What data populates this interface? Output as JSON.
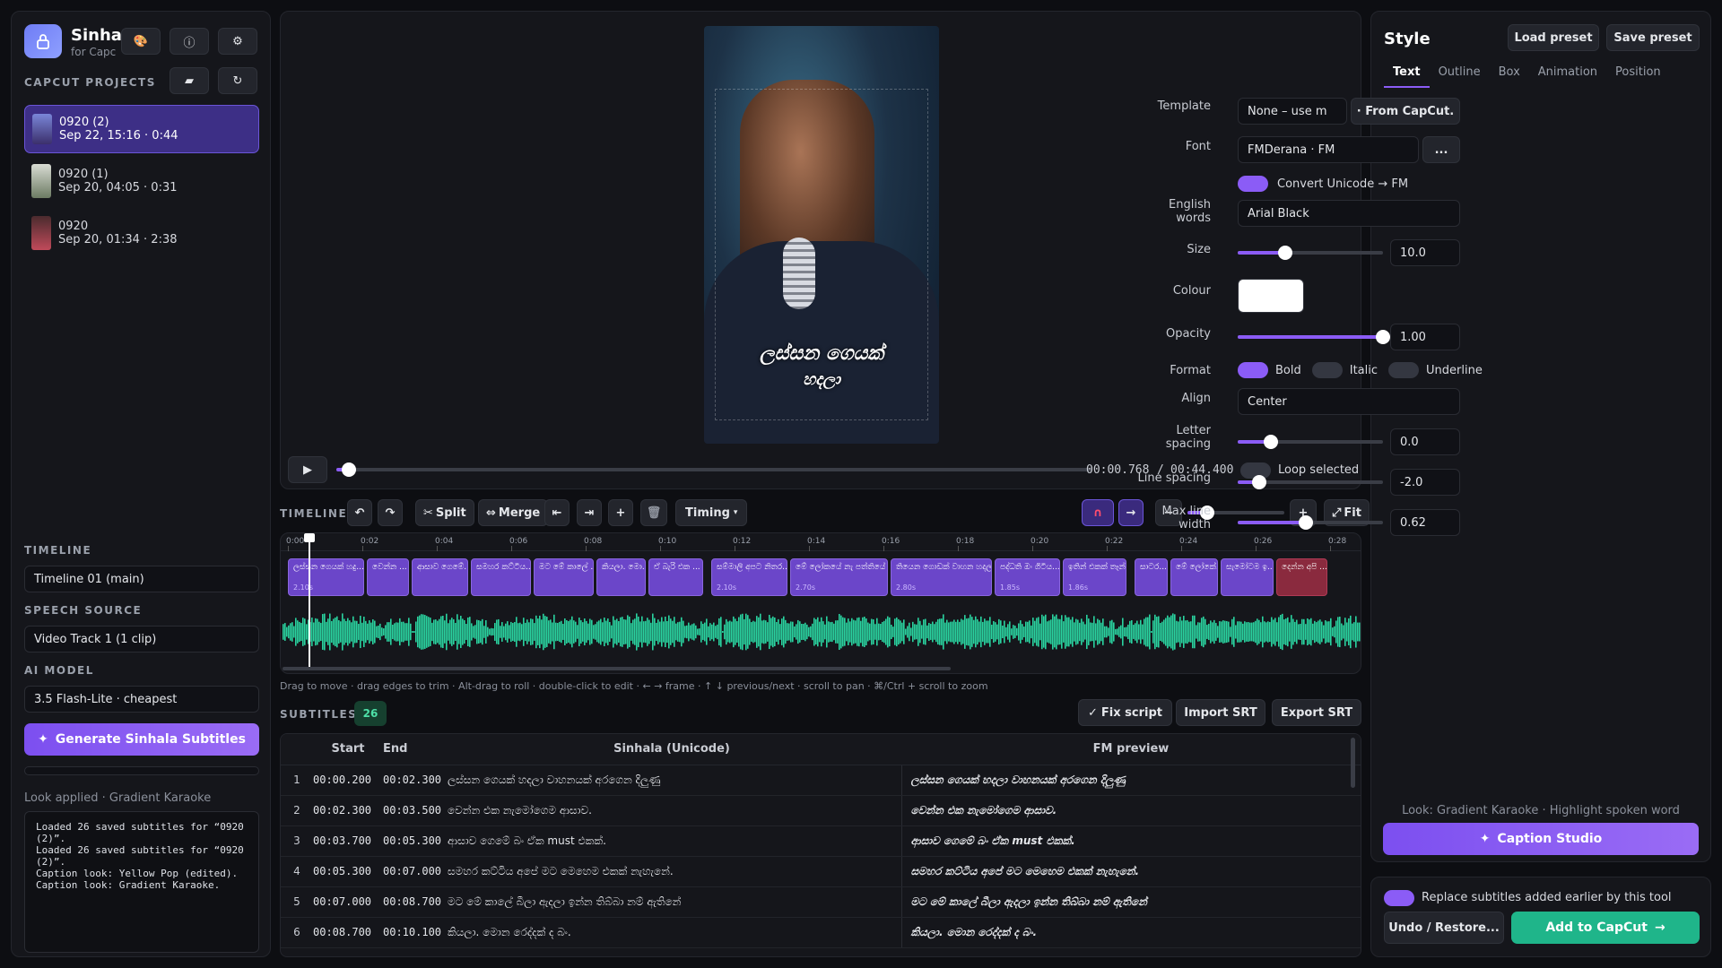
{
  "app": {
    "title": "Sinha",
    "subtitle": "for Capc",
    "logo_icon": "lock-icon"
  },
  "colors": {
    "accent": "#8b5cf6",
    "green": "#1fb58a",
    "waveform": "#2ad3a0",
    "bg": "#0d0e12"
  },
  "projects": {
    "heading": "CAPCUT PROJECTS",
    "items": [
      {
        "name": "0920 (2)",
        "meta": "Sep 22, 15:16 · 0:44",
        "selected": true
      },
      {
        "name": "0920 (1)",
        "meta": "Sep 20, 04:05 · 0:31",
        "selected": false
      },
      {
        "name": "0920",
        "meta": "Sep 20, 01:34 · 2:38",
        "selected": false
      }
    ]
  },
  "left": {
    "timeline_label": "TIMELINE",
    "timeline_value": "Timeline 01  (main)",
    "speech_label": "SPEECH SOURCE",
    "speech_value": "Video Track 1  (1 clip)",
    "model_label": "AI MODEL",
    "model_value": "3.5 Flash-Lite · cheapest",
    "generate_label": "Generate Sinhala Subtitles",
    "look_applied": "Look applied · Gradient Karaoke",
    "log": "Loaded 26 saved subtitles for “0920\n(2)”.\nLoaded 26 saved subtitles for “0920\n(2)”.\nCaption look: Yellow Pop (edited).\nCaption look: Gradient Karaoke."
  },
  "preview": {
    "caption_line1": "ලස්සන ගෙයක්",
    "caption_line2": "හදලා",
    "current_time": "00:00.768",
    "separator": "/",
    "total_time": "00:44.400",
    "progress": 0.017,
    "loop_label": "Loop selected"
  },
  "timeline_bar": {
    "label": "TIMELINE",
    "split": "Split",
    "merge": "Merge",
    "timing": "Timing",
    "fit": "Fit",
    "zoom": 0.2,
    "ruler": [
      "0:00",
      "0:02",
      "0:04",
      "0:06",
      "0:08",
      "0:10",
      "0:12",
      "0:14",
      "0:16",
      "0:18",
      "0:20",
      "0:22",
      "0:24",
      "0:26",
      "0:28"
    ],
    "hint": "Drag to move · drag edges to trim · Alt-drag to roll · double-click to edit · ← → frame · ↑ ↓ previous/next · scroll to pan · ⌘/Ctrl + scroll to zoom",
    "clips": [
      {
        "text": "ලස්සන ගෙයක් හදු...",
        "dur": "2.10s"
      },
      {
        "text": "වෙන්න ...",
        "dur": ""
      },
      {
        "text": "ආසාව ගෙමේ...",
        "dur": ""
      },
      {
        "text": "සමහර කට්ටිය...",
        "dur": ""
      },
      {
        "text": "මට මේ කාලේ ...",
        "dur": ""
      },
      {
        "text": "කියලා. මො...",
        "dur": ""
      },
      {
        "text": "ඒ බැරි එක ...",
        "dur": ""
      },
      {
        "text": "සම්මාලි අපට නිතර...",
        "dur": "2.10s"
      },
      {
        "text": "මේ ලෝකයේ නැ පත්තියේ ...",
        "dur": "2.70s"
      },
      {
        "text": "තියෙන ගොඩක් වාහන හදලා...",
        "dur": "2.80s"
      },
      {
        "text": "පද්ධති ඔං ගිටිය...",
        "dur": "1.85s"
      },
      {
        "text": "ඉතින් එකක් තෑන්...",
        "dur": "1.86s"
      },
      {
        "text": "සාටර...",
        "dur": ""
      },
      {
        "text": "මේ ලෝකේ...",
        "dur": ""
      },
      {
        "text": "සැමෝටම ඉ...",
        "dur": ""
      },
      {
        "text": "දෙන්න අපි ...",
        "dur": ""
      }
    ]
  },
  "subtitles": {
    "label": "SUBTITLES",
    "count": "26",
    "fix_script": "Fix script",
    "import": "Import SRT",
    "export": "Export SRT",
    "columns": [
      "Start",
      "End",
      "Sinhala (Unicode)",
      "FM preview"
    ],
    "rows": [
      {
        "n": "1",
        "start": "00:00.200",
        "end": "00:02.300",
        "sinhala": "ලස්සන ගෙයක් හදලා වාහනයක් අරගෙන දිලුණු",
        "fm": "ලස්සන ගෙයක් හදලා වාහනයක් අරගෙන දිලුණු"
      },
      {
        "n": "2",
        "start": "00:02.300",
        "end": "00:03.500",
        "sinhala": "වෙන්න එක නැමෝගෙම ආසාව.",
        "fm": "වෙන්න එක නැමෝගෙම ආසාව."
      },
      {
        "n": "3",
        "start": "00:03.700",
        "end": "00:05.300",
        "sinhala": "ආසාව ගෙමේ බං ඒක must එකක්.",
        "fm": "ආසාව ගෙමේ බං ඒක must එකක්."
      },
      {
        "n": "4",
        "start": "00:05.300",
        "end": "00:07.000",
        "sinhala": "සමහර කට්ටිය අපේ මට මෙහෙම එකක් නැහැනේ.",
        "fm": "සමහර කට්ටිය අපේ මට මෙහෙම එකක් නැහැනේ."
      },
      {
        "n": "5",
        "start": "00:07.000",
        "end": "00:08.700",
        "sinhala": "මට මේ කාලේ බීලා ඇදලා ඉන්න තිබ්බා නම් ඇතිනේ",
        "fm": "මට මේ කාලේ බීලා ඇදලා ඉන්න තිබ්බා නම් ඇතිනේ"
      },
      {
        "n": "6",
        "start": "00:08.700",
        "end": "00:10.100",
        "sinhala": "කියලා. මොන රෙද්දක් ද බං.",
        "fm": "කියලා. මොන රෙද්දක් ද බං."
      }
    ]
  },
  "style": {
    "title": "Style",
    "load_preset": "Load preset",
    "save_preset": "Save preset",
    "tabs": [
      "Text",
      "Outline",
      "Box",
      "Animation",
      "Position"
    ],
    "template_label": "Template",
    "template_value": "None – use m",
    "from_capcut": "· From CapCut.",
    "font_label": "Font",
    "font_value": "FMDerana   · FM",
    "font_more": "...",
    "convert_label": "Convert Unicode → FM",
    "english_label": "English words",
    "english_value": "Arial Black",
    "size_label": "Size",
    "size_value": "10.0",
    "size_level": 0.33,
    "colour_label": "Colour",
    "colour_value": "#ffffff",
    "opacity_label": "Opacity",
    "opacity_value": "1.00",
    "opacity_level": 1.0,
    "format_label": "Format",
    "bold": "Bold",
    "italic": "Italic",
    "underline": "Underline",
    "align_label": "Align",
    "align_value": "Center",
    "letter_label": "Letter spacing",
    "letter_value": "0.0",
    "letter_level": 0.23,
    "line_label": "Line spacing",
    "line_value": "-2.0",
    "line_level": 0.15,
    "maxw_label": "Max line width",
    "maxw_value": "0.62",
    "maxw_level": 0.47,
    "look_text": "Look: Gradient Karaoke · Highlight spoken word",
    "caption_studio": "Caption Studio"
  },
  "footer": {
    "replace_label": "Replace subtitles added earlier by this tool",
    "undo": "Undo / Restore...",
    "add": "Add to CapCut"
  }
}
